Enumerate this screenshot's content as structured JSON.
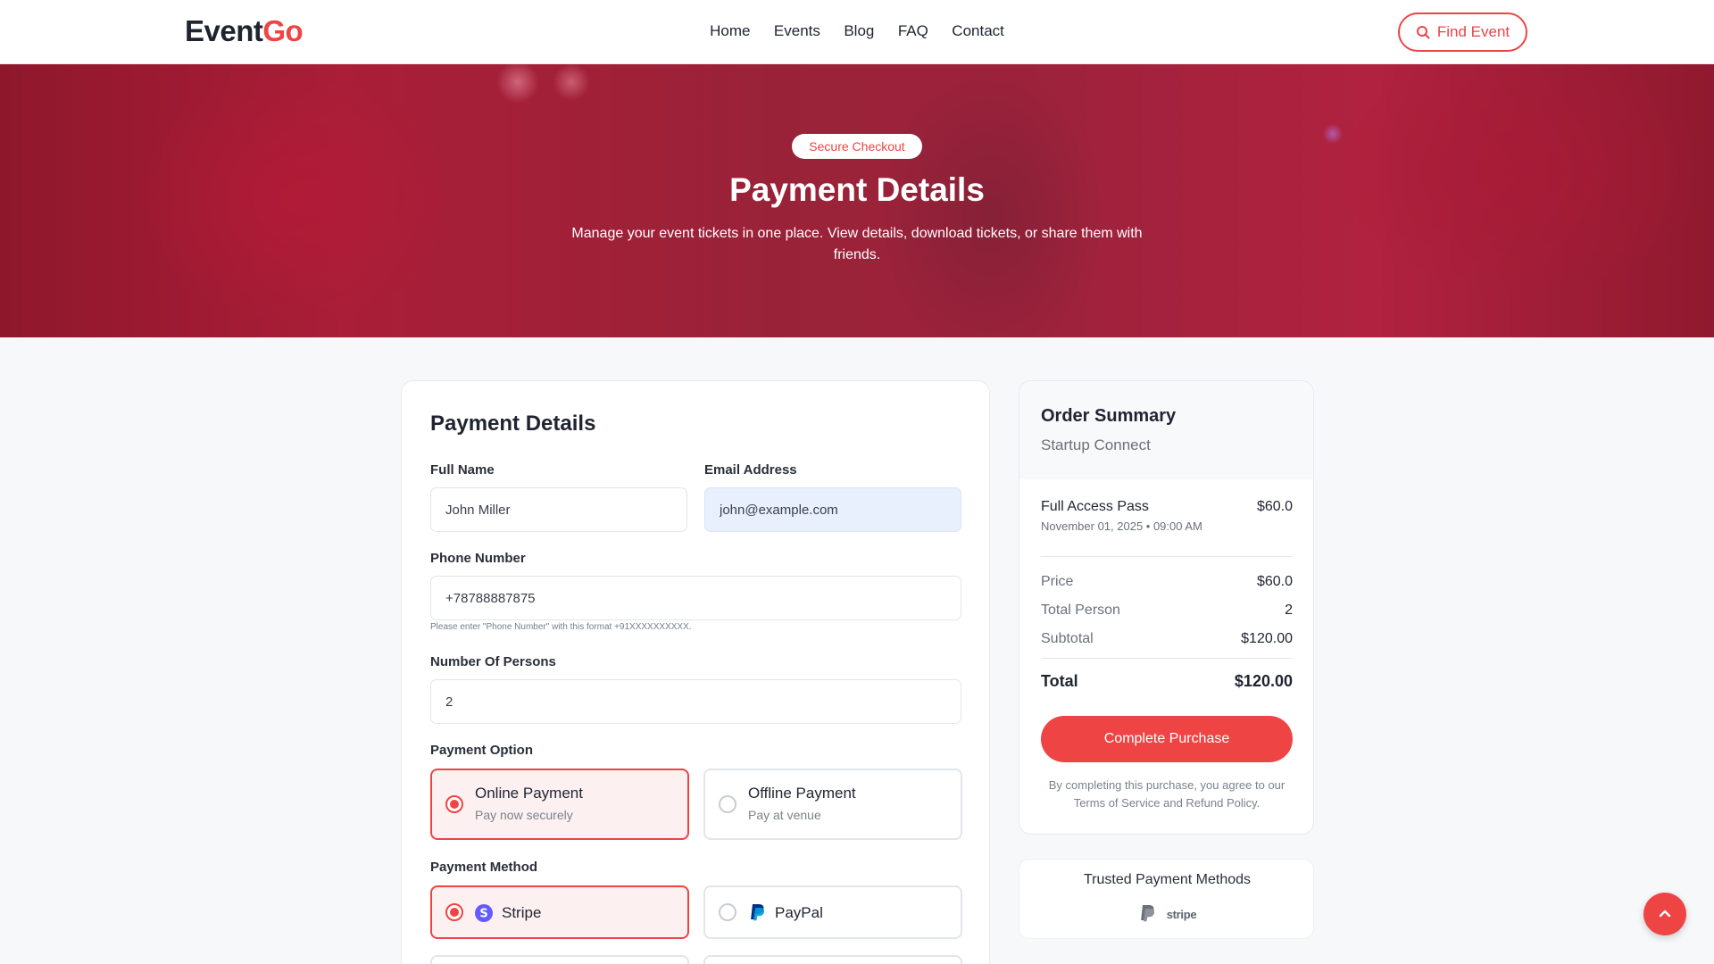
{
  "brand": {
    "name_main": "Event",
    "name_accent": "Go",
    "accent_color": "#ef4444"
  },
  "nav": {
    "items": [
      "Home",
      "Events",
      "Blog",
      "FAQ",
      "Contact"
    ],
    "find_button": "Find Event"
  },
  "hero": {
    "badge": "Secure Checkout",
    "title": "Payment Details",
    "subtitle": "Manage your event tickets in one place. View details, download tickets, or share them with friends."
  },
  "form": {
    "title": "Payment Details",
    "full_name": {
      "label": "Full Name",
      "value": "John Miller"
    },
    "email": {
      "label": "Email Address",
      "value": "john@example.com"
    },
    "phone": {
      "label": "Phone Number",
      "value": "+78788887875",
      "hint": "Please enter \"Phone Number\" with this format +91XXXXXXXXXX."
    },
    "persons": {
      "label": "Number Of Persons",
      "value": "2"
    },
    "payment_option": {
      "label": "Payment Option",
      "options": [
        {
          "title": "Online Payment",
          "subtitle": "Pay now securely",
          "selected": true
        },
        {
          "title": "Offline Payment",
          "subtitle": "Pay at venue",
          "selected": false
        }
      ]
    },
    "payment_method": {
      "label": "Payment Method",
      "methods": [
        {
          "name": "Stripe",
          "icon": "stripe-icon",
          "selected": true
        },
        {
          "name": "PayPal",
          "icon": "paypal-icon",
          "selected": false
        }
      ]
    }
  },
  "summary": {
    "title": "Order Summary",
    "event": "Startup Connect",
    "ticket": {
      "name": "Full Access Pass",
      "price": "$60.0",
      "datetime": "November 01, 2025 • 09:00 AM"
    },
    "rows": [
      {
        "label": "Price",
        "value": "$60.0"
      },
      {
        "label": "Total Person",
        "value": "2"
      },
      {
        "label": "Subtotal",
        "value": "$120.00"
      }
    ],
    "total": {
      "label": "Total",
      "value": "$120.00"
    },
    "button": "Complete Purchase",
    "terms": "By completing this purchase, you agree to our Terms of Service and Refund Policy."
  },
  "trusted": {
    "title": "Trusted Payment Methods",
    "icons": [
      "paypal-icon",
      "stripe-icon"
    ],
    "stripe_wordmark": "stripe"
  }
}
